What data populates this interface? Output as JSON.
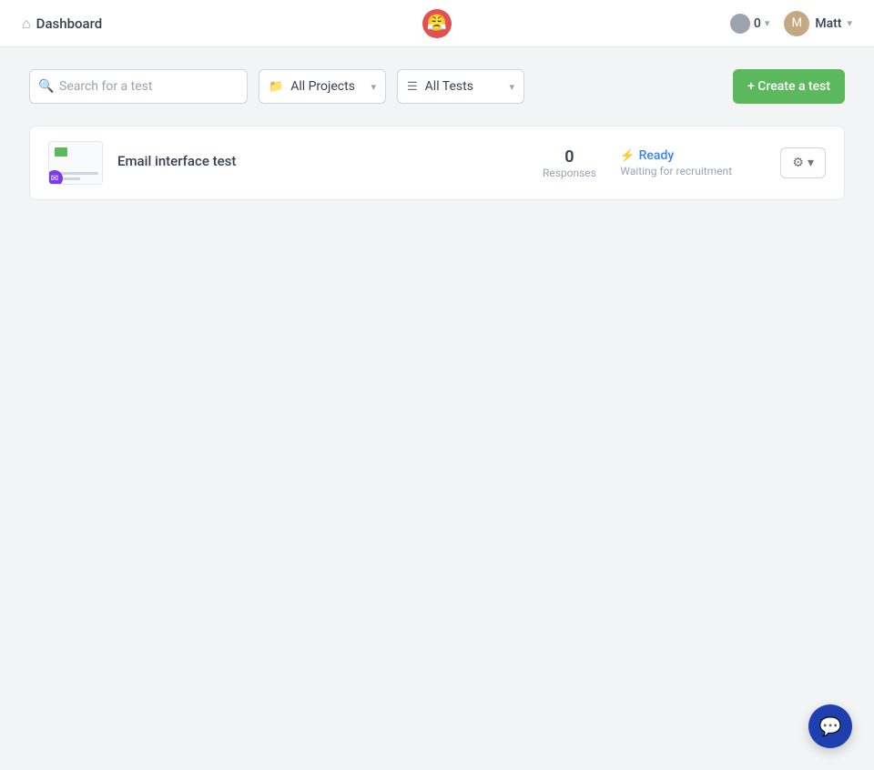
{
  "header": {
    "dashboard_label": "Dashboard",
    "app_emoji": "😤",
    "credits": {
      "count": "0"
    },
    "user": {
      "name": "Matt",
      "initials": "M"
    }
  },
  "toolbar": {
    "search_placeholder": "Search for a test",
    "projects_filter": {
      "label": "All Projects"
    },
    "tests_filter": {
      "label": "All Tests"
    },
    "create_button": "+ Create a test"
  },
  "tests": [
    {
      "name": "Email interface test",
      "responses_count": "0",
      "responses_label": "Responses",
      "status": "Ready",
      "status_subtext": "Waiting for recruitment"
    }
  ]
}
